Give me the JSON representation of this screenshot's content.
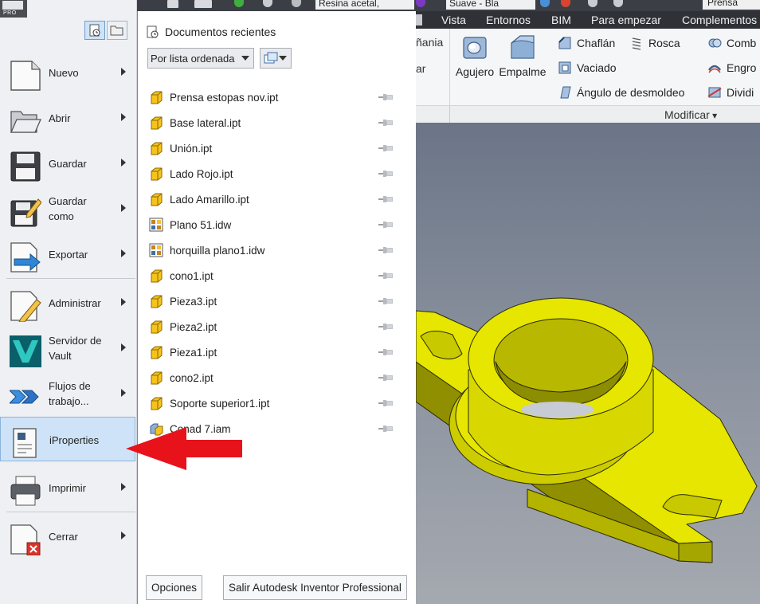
{
  "app": {
    "badge": "PRO",
    "material_dropdown": "Resina acetal,",
    "appearance_dropdown": "Suave - Bla",
    "window_title_fragment": "Prensa"
  },
  "ribbon": {
    "tabs": [
      "Vista",
      "Entornos",
      "BIM",
      "Para empezar",
      "Complementos"
    ],
    "cut_labels": [
      "ñania",
      "ar"
    ],
    "tools_big": [
      {
        "id": "agujero",
        "label": "Agujero"
      },
      {
        "id": "empalme",
        "label": "Empalme"
      }
    ],
    "tools_small": [
      {
        "id": "chaflan",
        "label": "Chaflán"
      },
      {
        "id": "vaciado",
        "label": "Vaciado"
      },
      {
        "id": "angulo",
        "label": "Ángulo de desmoldeo"
      },
      {
        "id": "rosca",
        "label": "Rosca"
      },
      {
        "id": "comb",
        "label": "Comb"
      },
      {
        "id": "engro",
        "label": "Engro"
      },
      {
        "id": "dividi",
        "label": "Dividi"
      }
    ],
    "panel_label": "Modificar"
  },
  "menu": {
    "items": [
      {
        "id": "nuevo",
        "label": "Nuevo",
        "has_submenu": true
      },
      {
        "id": "abrir",
        "label": "Abrir",
        "has_submenu": true
      },
      {
        "id": "guardar",
        "label": "Guardar",
        "has_submenu": true
      },
      {
        "id": "guardar-como",
        "label": "Guardar como",
        "has_submenu": true
      },
      {
        "id": "exportar",
        "label": "Exportar",
        "has_submenu": true
      },
      {
        "id": "administrar",
        "label": "Administrar",
        "has_submenu": true
      },
      {
        "id": "servidor-vault",
        "label": "Servidor de Vault",
        "has_submenu": true
      },
      {
        "id": "flujos",
        "label": "Flujos de trabajo...",
        "has_submenu": true
      },
      {
        "id": "iproperties",
        "label": "iProperties",
        "has_submenu": false,
        "selected": true
      },
      {
        "id": "imprimir",
        "label": "Imprimir",
        "has_submenu": true
      },
      {
        "id": "cerrar",
        "label": "Cerrar",
        "has_submenu": true
      }
    ]
  },
  "recent": {
    "title": "Documentos recientes",
    "sort_value": "Por lista ordenada",
    "files": [
      {
        "name": "Prensa estopas nov.ipt",
        "type": "ipt"
      },
      {
        "name": "Base lateral.ipt",
        "type": "ipt"
      },
      {
        "name": "Unión.ipt",
        "type": "ipt"
      },
      {
        "name": "Lado Rojo.ipt",
        "type": "ipt"
      },
      {
        "name": "Lado Amarillo.ipt",
        "type": "ipt"
      },
      {
        "name": "Plano 51.idw",
        "type": "idw"
      },
      {
        "name": "horquilla plano1.idw",
        "type": "idw"
      },
      {
        "name": "cono1.ipt",
        "type": "ipt"
      },
      {
        "name": "Pieza3.ipt",
        "type": "ipt"
      },
      {
        "name": "Pieza2.ipt",
        "type": "ipt"
      },
      {
        "name": "Pieza1.ipt",
        "type": "ipt"
      },
      {
        "name": "cono2.ipt",
        "type": "ipt"
      },
      {
        "name": "Soporte superior1.ipt",
        "type": "ipt"
      },
      {
        "name": "Conad 7.iam",
        "type": "iam"
      }
    ]
  },
  "footer": {
    "options_label": "Opciones",
    "exit_label": "Salir Autodesk Inventor Professional"
  },
  "colors": {
    "part_yellow": "#e6e600",
    "arrow_red": "#e8121b",
    "selection_blue": "#cfe3f8"
  }
}
